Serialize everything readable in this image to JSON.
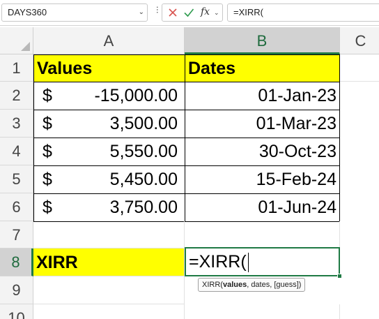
{
  "formula_bar": {
    "name_box": "DAYS360",
    "name_box_dropdown": "⌄",
    "fx_label": "fx",
    "fx_dropdown": "⌄",
    "formula_text": "=XIRR("
  },
  "columns": [
    {
      "letter": "A"
    },
    {
      "letter": "B"
    },
    {
      "letter": "C"
    }
  ],
  "rows": [
    "1",
    "2",
    "3",
    "4",
    "5",
    "6",
    "7",
    "8",
    "9",
    "10"
  ],
  "cells": {
    "a1": "Values",
    "b1": "Dates",
    "values": [
      {
        "currency": "$",
        "amount": "-15,000.00",
        "date": "01-Jan-23"
      },
      {
        "currency": "$",
        "amount": "3,500.00",
        "date": "01-Mar-23"
      },
      {
        "currency": "$",
        "amount": "5,550.00",
        "date": "30-Oct-23"
      },
      {
        "currency": "$",
        "amount": "5,450.00",
        "date": "15-Feb-24"
      },
      {
        "currency": "$",
        "amount": "3,750.00",
        "date": "01-Jun-24"
      }
    ],
    "a8": "XIRR",
    "b8_editing": "=XIRR("
  },
  "tooltip": {
    "func": "XIRR(",
    "arg_bold": "values",
    "rest": ", dates, [guess])"
  },
  "colors": {
    "highlight": "#ffff00",
    "accent": "#1f7a44"
  }
}
